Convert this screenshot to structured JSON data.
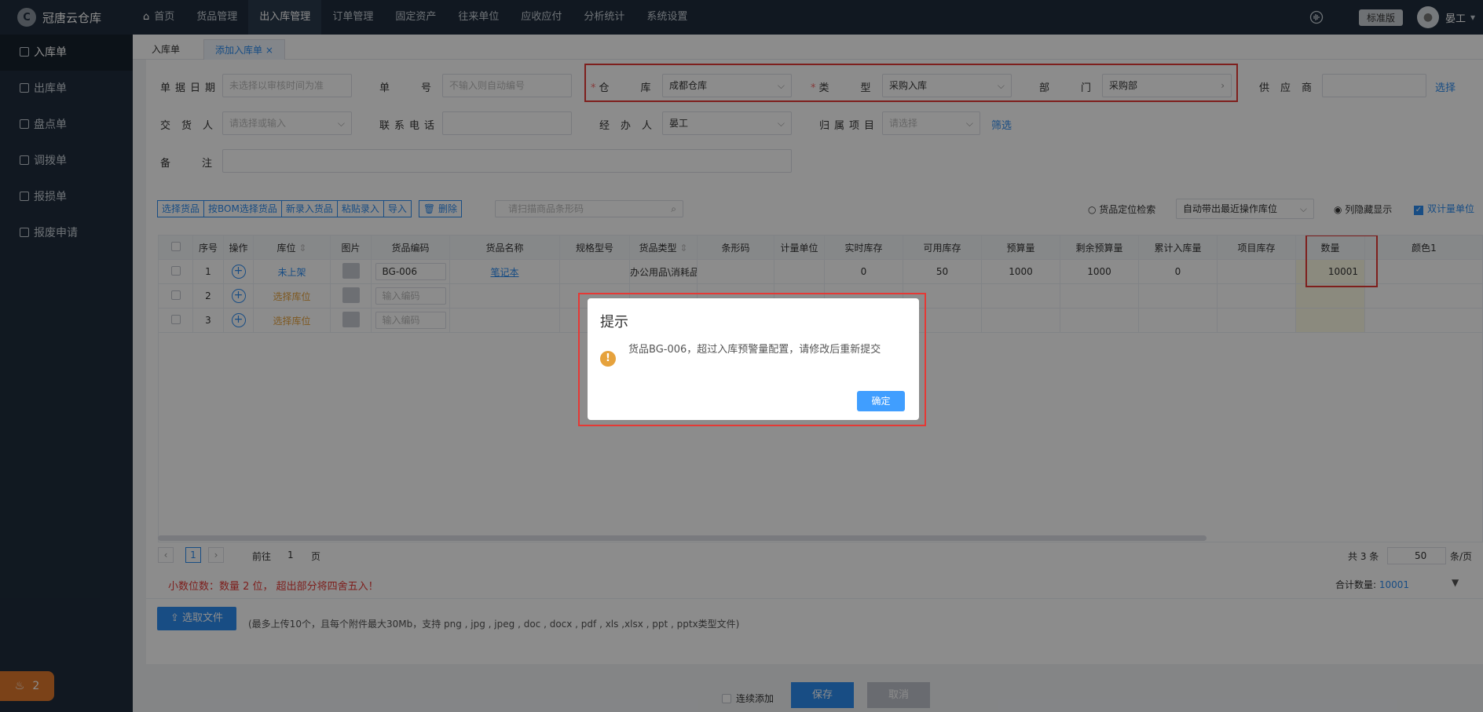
{
  "app": {
    "logo_text": "冠唐云仓库",
    "logo_mark": "C"
  },
  "nav": {
    "items": [
      "首页",
      "货品管理",
      "出入库管理",
      "订单管理",
      "固定资产",
      "往来单位",
      "应收应付",
      "分析统计",
      "系统设置"
    ],
    "active_index": 2
  },
  "topbar": {
    "version": "标准版",
    "user": "晏工",
    "caret": "▾"
  },
  "sidebar": {
    "items": [
      "入库单",
      "出库单",
      "盘点单",
      "调拨单",
      "报损单",
      "报废申请"
    ],
    "active_index": 0,
    "notice_count": "2"
  },
  "tabs": {
    "items": [
      "入库单",
      "添加入库单 ×"
    ],
    "active_index": 1
  },
  "form": {
    "date_label": "单据日期",
    "date_placeholder": "未选择以审核时间为准",
    "no_label": "单号",
    "no_placeholder": "不输入则自动编号",
    "warehouse_label": "仓库",
    "warehouse_value": "成都仓库",
    "type_label": "类型",
    "type_value": "采购入库",
    "dept_label": "部门",
    "dept_value": "采购部",
    "supplier_label": "供应商",
    "supplier_link": "选择",
    "deliverer_label": "交货人",
    "deliverer_placeholder": "请选择或输入",
    "phone_label": "联系电话",
    "handler_label": "经办人",
    "handler_value": "晏工",
    "project_label": "归属项目",
    "project_placeholder": "请选择",
    "project_link": "筛选",
    "remark_label": "备注",
    "required_mark": "*",
    "dd_icon": "⌵",
    "arrow_icon": "›"
  },
  "toolbar": {
    "buttons": [
      "选择货品",
      "按BOM选择货品",
      "新录入货品",
      "粘贴录入",
      "导入"
    ],
    "delete_label": "删除",
    "scan_placeholder": "请扫描商品条形码",
    "locate_label": "货品定位检索",
    "location_select": "自动带出最近操作库位",
    "hidden_cols_label": "列隐藏显示",
    "dual_unit_label": "双计量单位"
  },
  "table": {
    "headers": [
      "序号",
      "操作",
      "库位",
      "图片",
      "货品编码",
      "货品名称",
      "规格型号",
      "货品类型",
      "条形码",
      "计量单位",
      "实时库存",
      "可用库存",
      "预算量",
      "剩余预算量",
      "累计入库量",
      "项目库存",
      "数量",
      "颜色1"
    ],
    "rows": [
      {
        "no": "1",
        "location": "未上架",
        "code": "BG-006",
        "name": "笔记本",
        "type": "办公用品\\消耗品",
        "stock": "0",
        "available": "50",
        "budget": "1000",
        "remaining": "1000",
        "accumulated": "0",
        "qty": "10001"
      },
      {
        "no": "2",
        "location": "选择库位",
        "code_placeholder": "输入编码"
      },
      {
        "no": "3",
        "location": "选择库位",
        "code_placeholder": "输入编码"
      }
    ]
  },
  "pager": {
    "prev": "‹",
    "next": "›",
    "page": "1",
    "goto_label": "前往",
    "goto_value": "1",
    "page_unit": "页",
    "total": "共 3 条",
    "size": "50",
    "size_unit": "条/页"
  },
  "notes": {
    "decimal": "小数位数：数量 2 位， 超出部分将四舍五入！",
    "sum_label": "合计数量:",
    "sum_value": "10001"
  },
  "upload": {
    "button": "选取文件",
    "hint": "(最多上传10个，且每个附件最大30Mb，支持 png , jpg , jpeg , doc , docx , pdf , xls ,xlsx , ppt , pptx类型文件)"
  },
  "footer": {
    "continuous": "连续添加",
    "save": "保存",
    "cancel": "取消"
  },
  "modal": {
    "title": "提示",
    "icon": "!",
    "message": "货品BG-006，超过入库预警量配置，请修改后重新提交",
    "ok": "确定"
  }
}
